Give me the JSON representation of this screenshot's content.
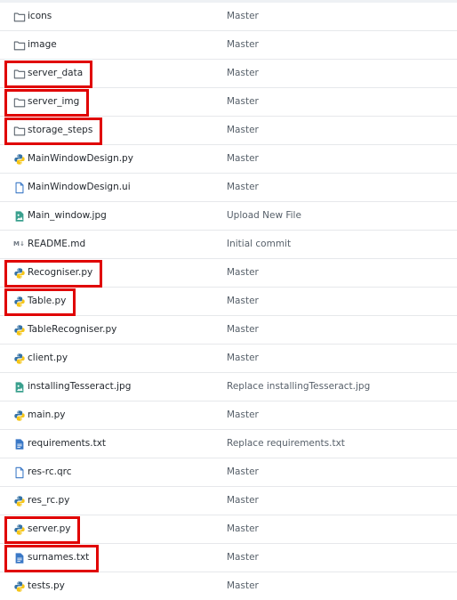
{
  "files": [
    {
      "name": "icons",
      "type": "folder",
      "commit": "Master",
      "highlighted": false
    },
    {
      "name": "image",
      "type": "folder",
      "commit": "Master",
      "highlighted": false
    },
    {
      "name": "server_data",
      "type": "folder",
      "commit": "Master",
      "highlighted": true
    },
    {
      "name": "server_img",
      "type": "folder",
      "commit": "Master",
      "highlighted": true
    },
    {
      "name": "storage_steps",
      "type": "folder",
      "commit": "Master",
      "highlighted": true
    },
    {
      "name": "MainWindowDesign.py",
      "type": "python",
      "commit": "Master",
      "highlighted": false
    },
    {
      "name": "MainWindowDesign.ui",
      "type": "file",
      "commit": "Master",
      "highlighted": false
    },
    {
      "name": "Main_window.jpg",
      "type": "image",
      "commit": "Upload New File",
      "highlighted": false
    },
    {
      "name": "README.md",
      "type": "markdown",
      "commit": "Initial commit",
      "highlighted": false
    },
    {
      "name": "Recogniser.py",
      "type": "python",
      "commit": "Master",
      "highlighted": true
    },
    {
      "name": "Table.py",
      "type": "python",
      "commit": "Master",
      "highlighted": true
    },
    {
      "name": "TableRecogniser.py",
      "type": "python",
      "commit": "Master",
      "highlighted": false
    },
    {
      "name": "client.py",
      "type": "python",
      "commit": "Master",
      "highlighted": false
    },
    {
      "name": "installingTesseract.jpg",
      "type": "image",
      "commit": "Replace installingTesseract.jpg",
      "highlighted": false
    },
    {
      "name": "main.py",
      "type": "python",
      "commit": "Master",
      "highlighted": false
    },
    {
      "name": "requirements.txt",
      "type": "text",
      "commit": "Replace requirements.txt",
      "highlighted": false
    },
    {
      "name": "res-rc.qrc",
      "type": "file",
      "commit": "Master",
      "highlighted": false
    },
    {
      "name": "res_rc.py",
      "type": "python",
      "commit": "Master",
      "highlighted": false
    },
    {
      "name": "server.py",
      "type": "python",
      "commit": "Master",
      "highlighted": true
    },
    {
      "name": "surnames.txt",
      "type": "text",
      "commit": "Master",
      "highlighted": true
    },
    {
      "name": "tests.py",
      "type": "python",
      "commit": "Master",
      "highlighted": false
    }
  ],
  "markdown_icon_text": "M↓",
  "colors": {
    "highlight": "#e00000",
    "folder": "#57606a",
    "file": "#3a78c6",
    "image": "#3aa08e"
  }
}
